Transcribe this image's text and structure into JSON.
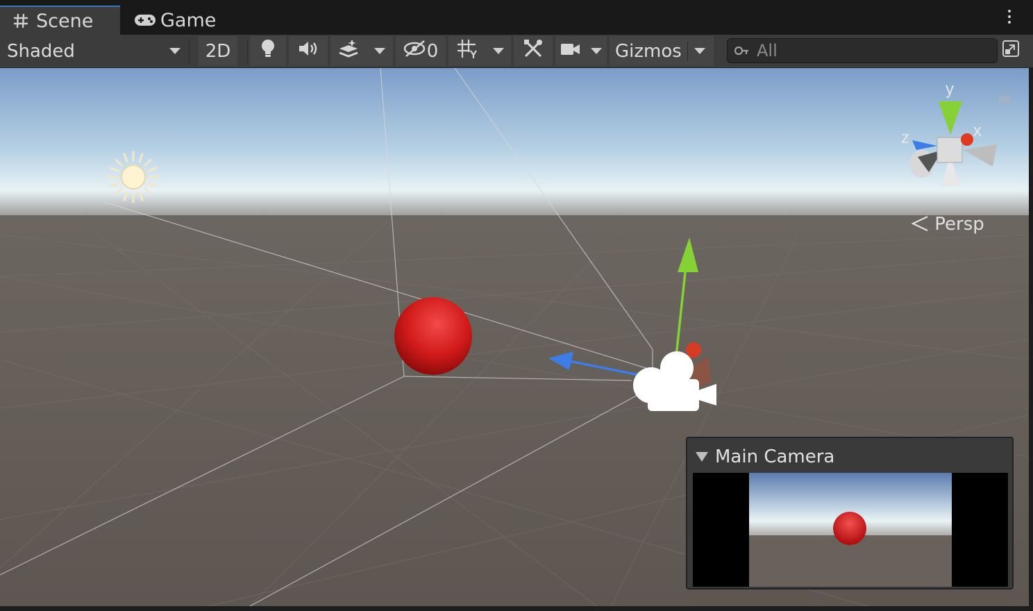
{
  "tabs": {
    "scene": "Scene",
    "game": "Game"
  },
  "toolbar": {
    "shading_mode": "Shaded",
    "mode_2d": "2D",
    "hidden_count": "0",
    "gizmos": "Gizmos",
    "search_placeholder": "All"
  },
  "scene_view": {
    "projection": "Persp",
    "gizmo_axes": {
      "x": "x",
      "y": "y",
      "z": "z"
    }
  },
  "camera_preview": {
    "title": "Main Camera"
  },
  "colors": {
    "sky_top": "#7a9cc8",
    "horizon": "#e8f2f6",
    "ground": "#615a55",
    "sphere": "#d21a1a",
    "axis_x": "#e0391e",
    "axis_y": "#86d135",
    "axis_z": "#3d7de8",
    "accent_tab": "#3a79bb"
  }
}
